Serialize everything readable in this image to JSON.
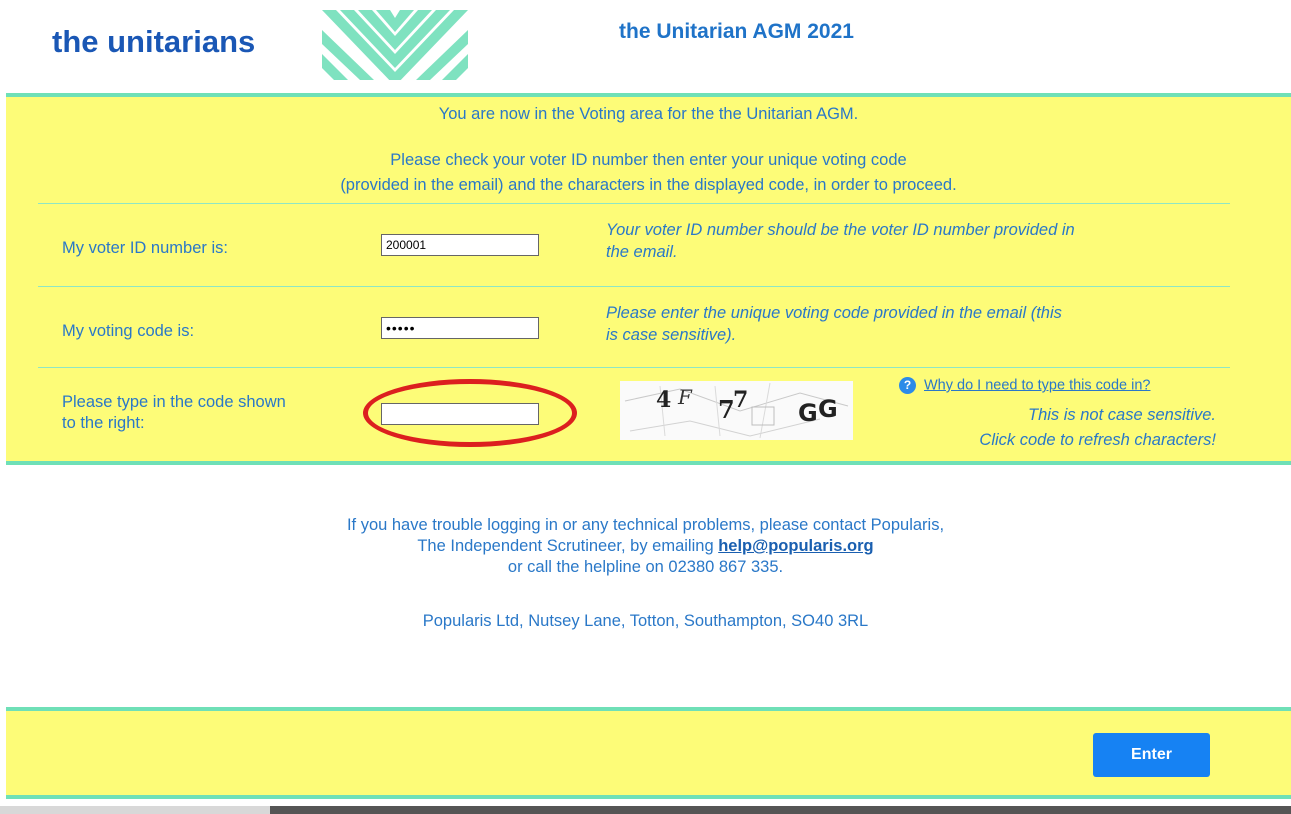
{
  "header": {
    "logo_text": "the  unitarians",
    "title": "the Unitarian AGM 2021"
  },
  "intro": {
    "line1": "You are now in the Voting area for the the Unitarian AGM.",
    "line2": "Please check your voter ID number then enter your unique voting code",
    "line3": "(provided in the email) and the characters in the displayed code, in order to proceed."
  },
  "form": {
    "voter_id": {
      "label": "My voter ID number is:",
      "value": "200001",
      "help_line1": "Your voter ID number should be the voter ID number provided in",
      "help_line2": "the email."
    },
    "voting_code": {
      "label": "My voting code is:",
      "value": "•••••",
      "help_line1": "Please enter the unique voting code provided in the email (this",
      "help_line2": "is case sensitive)."
    },
    "captcha": {
      "label_line1": "Please type in the code shown",
      "label_line2": "to the right:",
      "value": "",
      "chars": [
        "4",
        "F",
        "7",
        "7",
        "G",
        "G"
      ],
      "why_link": "Why do I need to type this code in?",
      "note_line1": "This is not case sensitive.",
      "note_line2": "Click code to refresh characters!"
    }
  },
  "contact": {
    "line1": "If you have trouble logging in or any technical problems, please contact Popularis,",
    "line2_prefix": "The Independent Scrutineer, by emailing ",
    "email": "help@popularis.org",
    "line3": "or call the helpline on 02380 867 335.",
    "address": "Popularis Ltd, Nutsey Lane, Totton, Southampton, SO40 3RL"
  },
  "footer": {
    "enter_label": "Enter"
  },
  "colors": {
    "panel_yellow": "#fdfc78",
    "border_green": "#6fe0b7",
    "text_blue": "#2a78c8",
    "button_blue": "#1682f3",
    "highlight_red": "#dc1f1f"
  },
  "icons": {
    "help": "question-circle-icon",
    "logo_mark": "chevron-stripes-logo"
  }
}
